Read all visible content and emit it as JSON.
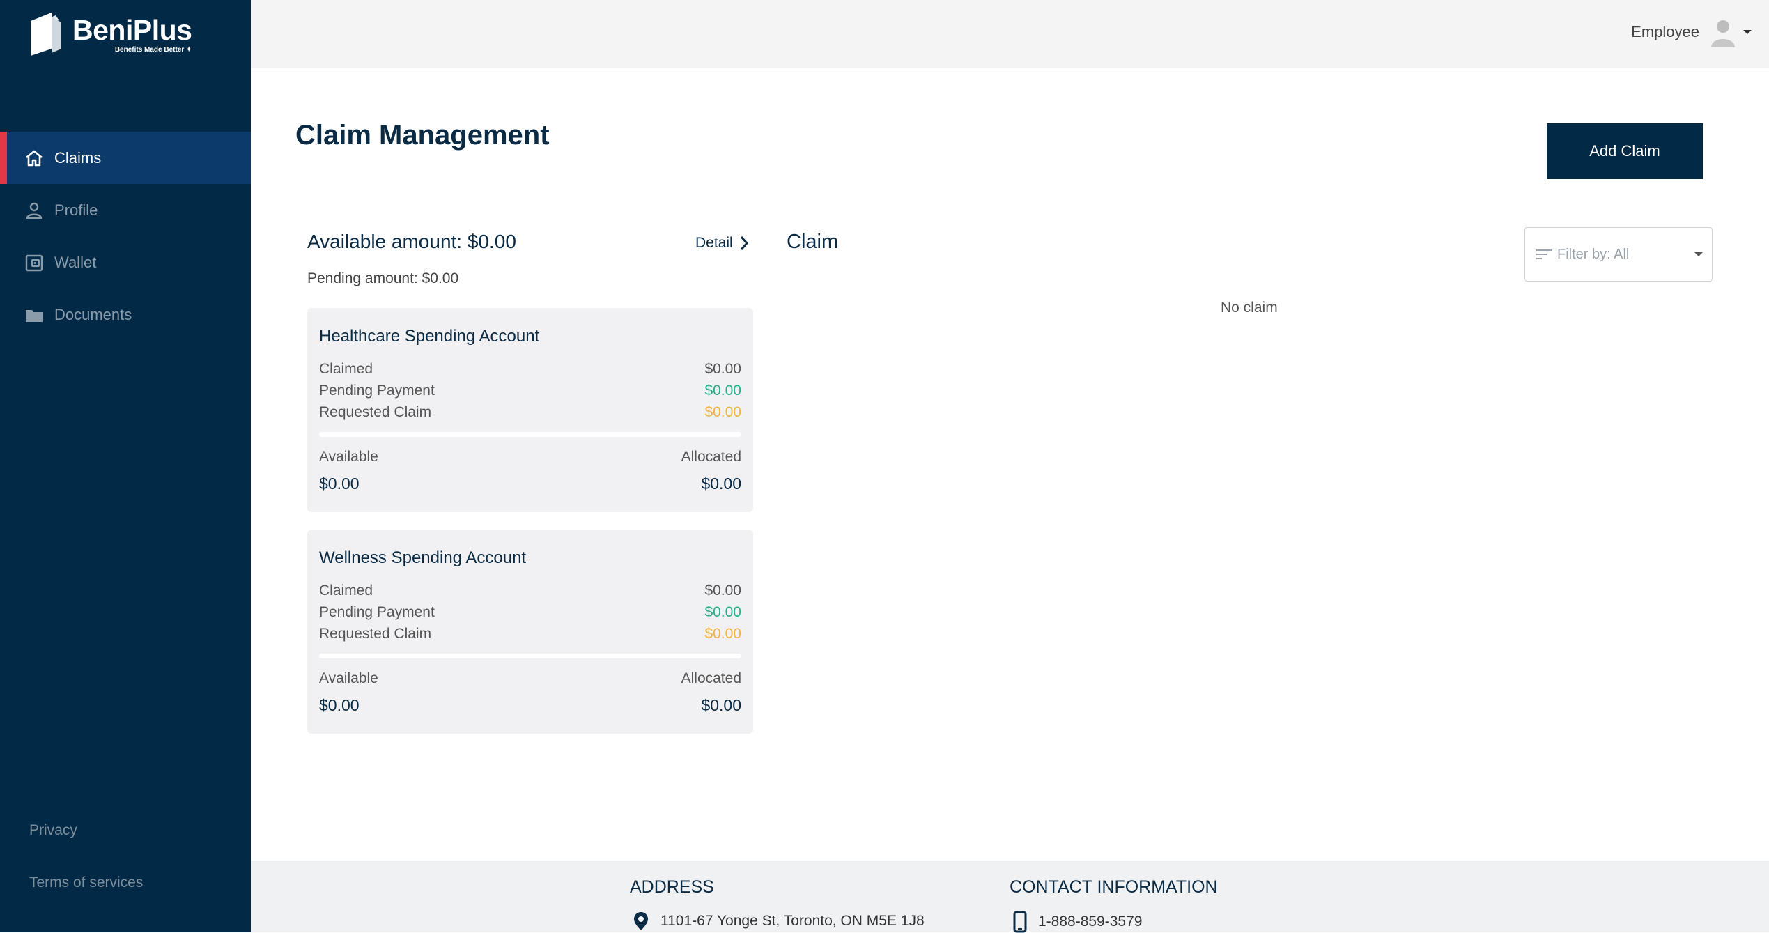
{
  "brand": {
    "name": "BeniPlus",
    "tagline": "Benefits Made Better ✦"
  },
  "sidebar": {
    "items": [
      {
        "label": "Claims",
        "icon": "home-icon",
        "active": true
      },
      {
        "label": "Profile",
        "icon": "person-icon",
        "active": false
      },
      {
        "label": "Wallet",
        "icon": "wallet-icon",
        "active": false
      },
      {
        "label": "Documents",
        "icon": "folder-icon",
        "active": false
      }
    ],
    "footer_links": [
      "Privacy",
      "Terms of services"
    ]
  },
  "header": {
    "user_role": "Employee"
  },
  "main": {
    "title": "Claim Management",
    "add_button": "Add Claim",
    "summary": {
      "available": "Available amount: $0.00",
      "detail": "Detail",
      "pending": "Pending amount: $0.00"
    },
    "accounts": [
      {
        "title": "Healthcare Spending Account",
        "rows": [
          {
            "label": "Claimed",
            "value": "$0.00"
          },
          {
            "label": "Pending Payment",
            "value": "$0.00"
          },
          {
            "label": "Requested Claim",
            "value": "$0.00"
          }
        ],
        "available_label": "Available",
        "allocated_label": "Allocated",
        "available_value": "$0.00",
        "allocated_value": "$0.00"
      },
      {
        "title": "Wellness Spending Account",
        "rows": [
          {
            "label": "Claimed",
            "value": "$0.00"
          },
          {
            "label": "Pending Payment",
            "value": "$0.00"
          },
          {
            "label": "Requested Claim",
            "value": "$0.00"
          }
        ],
        "available_label": "Available",
        "allocated_label": "Allocated",
        "available_value": "$0.00",
        "allocated_value": "$0.00"
      }
    ],
    "claim": {
      "title": "Claim",
      "filter": "Filter by: All",
      "empty": "No claim"
    }
  },
  "footer": {
    "address_heading": "ADDRESS",
    "address": "1101-67 Yonge St, Toronto, ON M5E 1J8",
    "contact_heading": "CONTACT INFORMATION",
    "phone": "1-888-859-3579"
  },
  "colors": {
    "sidebar": "#022a47",
    "active_nav": "#0c3a6a",
    "active_marker": "#e23744",
    "pending_green": "#26b08a",
    "requested_orange": "#f2b43d"
  }
}
